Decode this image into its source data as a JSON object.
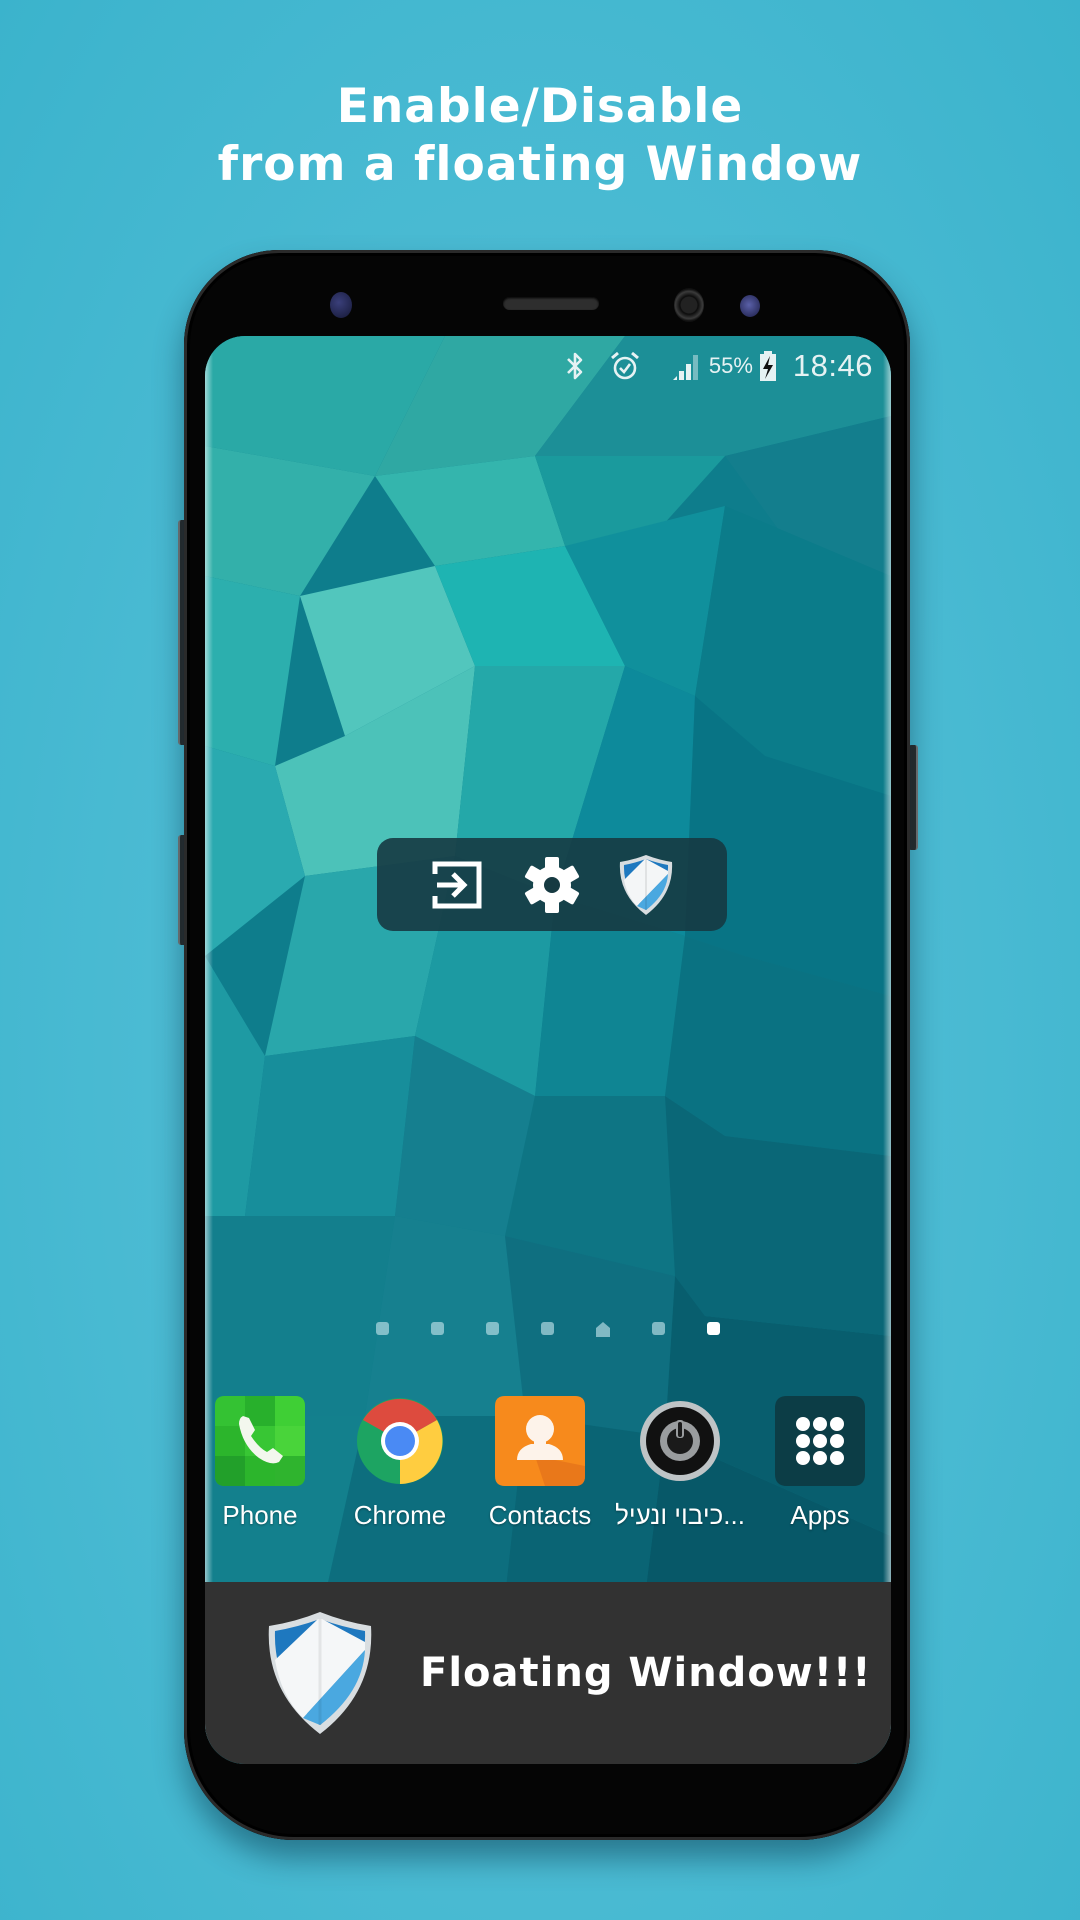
{
  "promo": {
    "headline_line1": "Enable/Disable",
    "headline_line2": "from a floating Window"
  },
  "status_bar": {
    "icons": [
      "bluetooth-icon",
      "alarm-icon",
      "signal-icon",
      "battery-charging-icon"
    ],
    "battery_percent": "55%",
    "time": "18:46"
  },
  "floating_window": {
    "buttons": [
      {
        "name": "exit-icon",
        "label": "Exit"
      },
      {
        "name": "settings-icon",
        "label": "Settings"
      },
      {
        "name": "shield-icon",
        "label": "Toggle protection"
      }
    ],
    "bg_color": "#163a42"
  },
  "home": {
    "page_count": 7,
    "home_page_index": 4,
    "active_page_index": 6
  },
  "dock": {
    "apps": [
      {
        "label": "Phone",
        "icon": "phone-icon"
      },
      {
        "label": "Chrome",
        "icon": "chrome-icon"
      },
      {
        "label": "Contacts",
        "icon": "contacts-icon"
      },
      {
        "label": "כיבוי ונעיל...",
        "icon": "power-icon"
      },
      {
        "label": "Apps",
        "icon": "apps-grid-icon"
      }
    ]
  },
  "banner": {
    "text": "Floating Window!!!",
    "bg_color": "#323232",
    "shield_colors": [
      "#1e78bf",
      "#4aa8e0",
      "#ffffff"
    ]
  },
  "colors": {
    "background": "#4dbcd4",
    "wallpaper": "#0f7f8e"
  }
}
